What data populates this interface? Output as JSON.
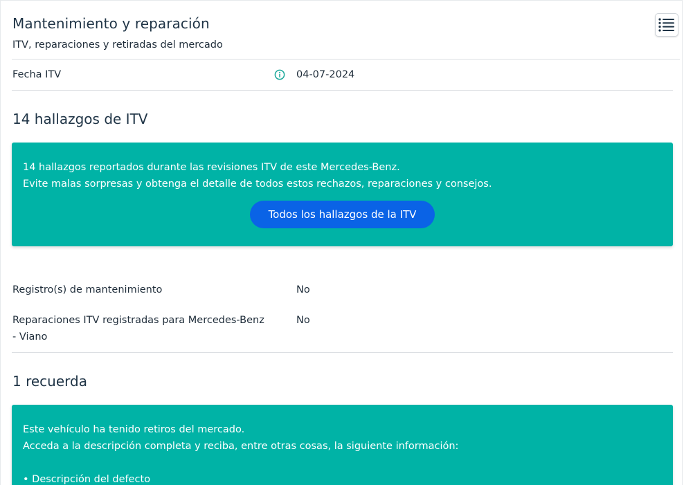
{
  "header": {
    "title": "Mantenimiento y reparación",
    "subtitle": "ITV, reparaciones y retiradas del mercado",
    "menu_icon": "list-menu-icon"
  },
  "itv_date": {
    "label": "Fecha ITV",
    "value": "04-07-2024",
    "icon": "info-icon"
  },
  "findings": {
    "title": "14 hallazgos de ITV",
    "line1": "14 hallazgos reportados durante las revisiones ITV de este Mercedes-Benz.",
    "line2": "Evite malas sorpresas y obtenga el detalle de todos estos rechazos, reparaciones y consejos.",
    "button_label": "Todos los hallazgos de la ITV"
  },
  "maintenance": {
    "records_label": "Registro(s) de mantenimiento",
    "records_value": "No",
    "repairs_label_line1": "Reparaciones ITV registradas para Mercedes-Benz",
    "repairs_label_line2": "- Viano",
    "repairs_value": "No"
  },
  "recalls": {
    "title": "1 recuerda",
    "line1": "Este vehículo ha tenido retiros del mercado.",
    "line2": "Acceda a la descripción completa y reciba, entre otras cosas, la siguiente información:",
    "bullet1": "• Descripción del defecto"
  },
  "colors": {
    "teal": "#00b3a6",
    "button_blue": "#0a63e6",
    "info_teal": "#1aa89a"
  }
}
